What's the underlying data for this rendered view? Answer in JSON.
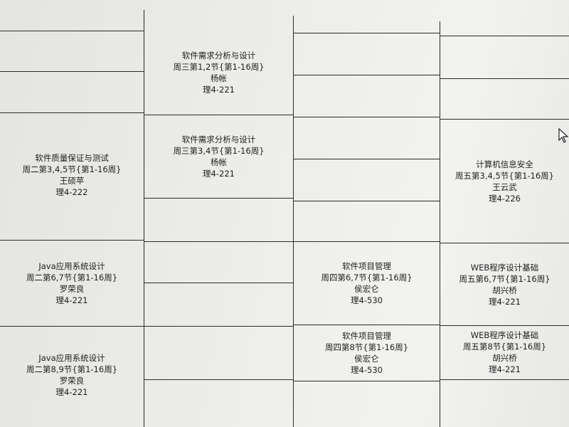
{
  "courses": [
    {
      "id": "wed-12",
      "name": "软件需求分析与设计",
      "time": "周三第1,2节{第1-16周}",
      "teacher": "杨帐",
      "room": "理4-221"
    },
    {
      "id": "wed-34",
      "name": "软件需求分析与设计",
      "time": "周三第3,4节{第1-16周}",
      "teacher": "杨帐",
      "room": "理4-221"
    },
    {
      "id": "tue-345",
      "name": "软件质量保证与测试",
      "time": "周二第3,4,5节{第1-16周}",
      "teacher": "王硕苹",
      "room": "理4-222"
    },
    {
      "id": "fri-345",
      "name": "计算机信息安全",
      "time": "周五第3,4,5节{第1-16周}",
      "teacher": "王云武",
      "room": "理4-226"
    },
    {
      "id": "tue-67",
      "name": "Java应用系统设计",
      "time": "周二第6,7节{第1-16周}",
      "teacher": "罗荣良",
      "room": "理4-221"
    },
    {
      "id": "thu-67",
      "name": "软件项目管理",
      "time": "周四第6,7节{第1-16周}",
      "teacher": "侯宏仑",
      "room": "理4-530"
    },
    {
      "id": "fri-67",
      "name": "WEB程序设计基础",
      "time": "周五第6,7节{第1-16周}",
      "teacher": "胡兴桥",
      "room": "理4-221"
    },
    {
      "id": "tue-89",
      "name": "Java应用系统设计",
      "time": "周二第8,9节{第1-16周}",
      "teacher": "罗荣良",
      "room": "理4-221"
    },
    {
      "id": "thu-8",
      "name": "软件项目管理",
      "time": "周四第8节{第1-16周}",
      "teacher": "侯宏仑",
      "room": "理4-530"
    },
    {
      "id": "fri-8",
      "name": "WEB程序设计基础",
      "time": "周五第8节{第1-16周}",
      "teacher": "胡兴桥",
      "room": "理4-221"
    }
  ],
  "colors": {
    "grid_line": "#2a2a2a",
    "text": "#1e1e1e",
    "background": "#e8e8e6"
  },
  "icons": {
    "cursor": "mouse-pointer-icon"
  }
}
